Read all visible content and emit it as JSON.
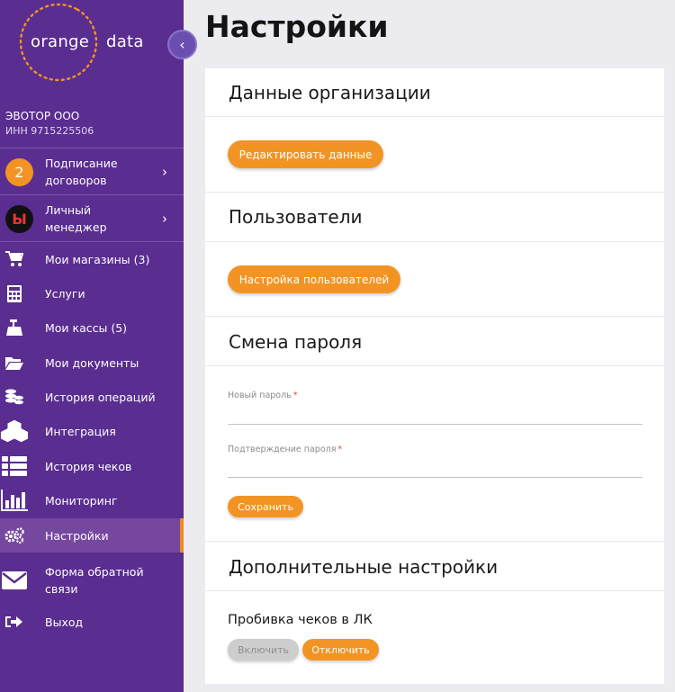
{
  "brand": {
    "word1": "orange",
    "word2": "data",
    "accent": "#f29424",
    "sidebar_bg": "#5a2d90"
  },
  "org": {
    "name": "ЭВОТОР ООО",
    "inn": "ИНН 9715225506"
  },
  "sidebar": {
    "promos": [
      {
        "badge": "2",
        "label": "Подписание договоров"
      },
      {
        "badge": "Ы",
        "label": "Личный менеджер"
      }
    ],
    "items": [
      {
        "label": "Мои магазины (3)",
        "icon": "cart-icon"
      },
      {
        "label": "Услуги",
        "icon": "calculator-icon"
      },
      {
        "label": "Мои кассы (5)",
        "icon": "cash-register-icon"
      },
      {
        "label": "Мои документы",
        "icon": "folder-open-icon"
      },
      {
        "label": "История операций",
        "icon": "coins-icon"
      },
      {
        "label": "Интеграция",
        "icon": "cubes-icon"
      },
      {
        "label": "История чеков",
        "icon": "list-icon"
      },
      {
        "label": "Мониторинг",
        "icon": "bar-chart-icon"
      },
      {
        "label": "Настройки",
        "icon": "gears-icon",
        "active": true
      },
      {
        "label": "Форма обратной связи",
        "icon": "envelope-icon"
      },
      {
        "label": "Выход",
        "icon": "sign-out-icon"
      }
    ]
  },
  "page": {
    "title": "Настройки"
  },
  "sections": {
    "org_data": {
      "title": "Данные организации",
      "button": "Редактировать данные"
    },
    "users": {
      "title": "Пользователи",
      "button": "Настройка пользователей"
    },
    "password": {
      "title": "Смена пароля",
      "new_label": "Новый пароль",
      "confirm_label": "Подтверждение пароля",
      "required_mark": "*",
      "new_value": "",
      "confirm_value": "",
      "save": "Сохранить"
    },
    "extra": {
      "title": "Дополнительные настройки",
      "subtitle": "Пробивка чеков в ЛК",
      "enable": "Включить",
      "disable": "Отключить"
    }
  }
}
